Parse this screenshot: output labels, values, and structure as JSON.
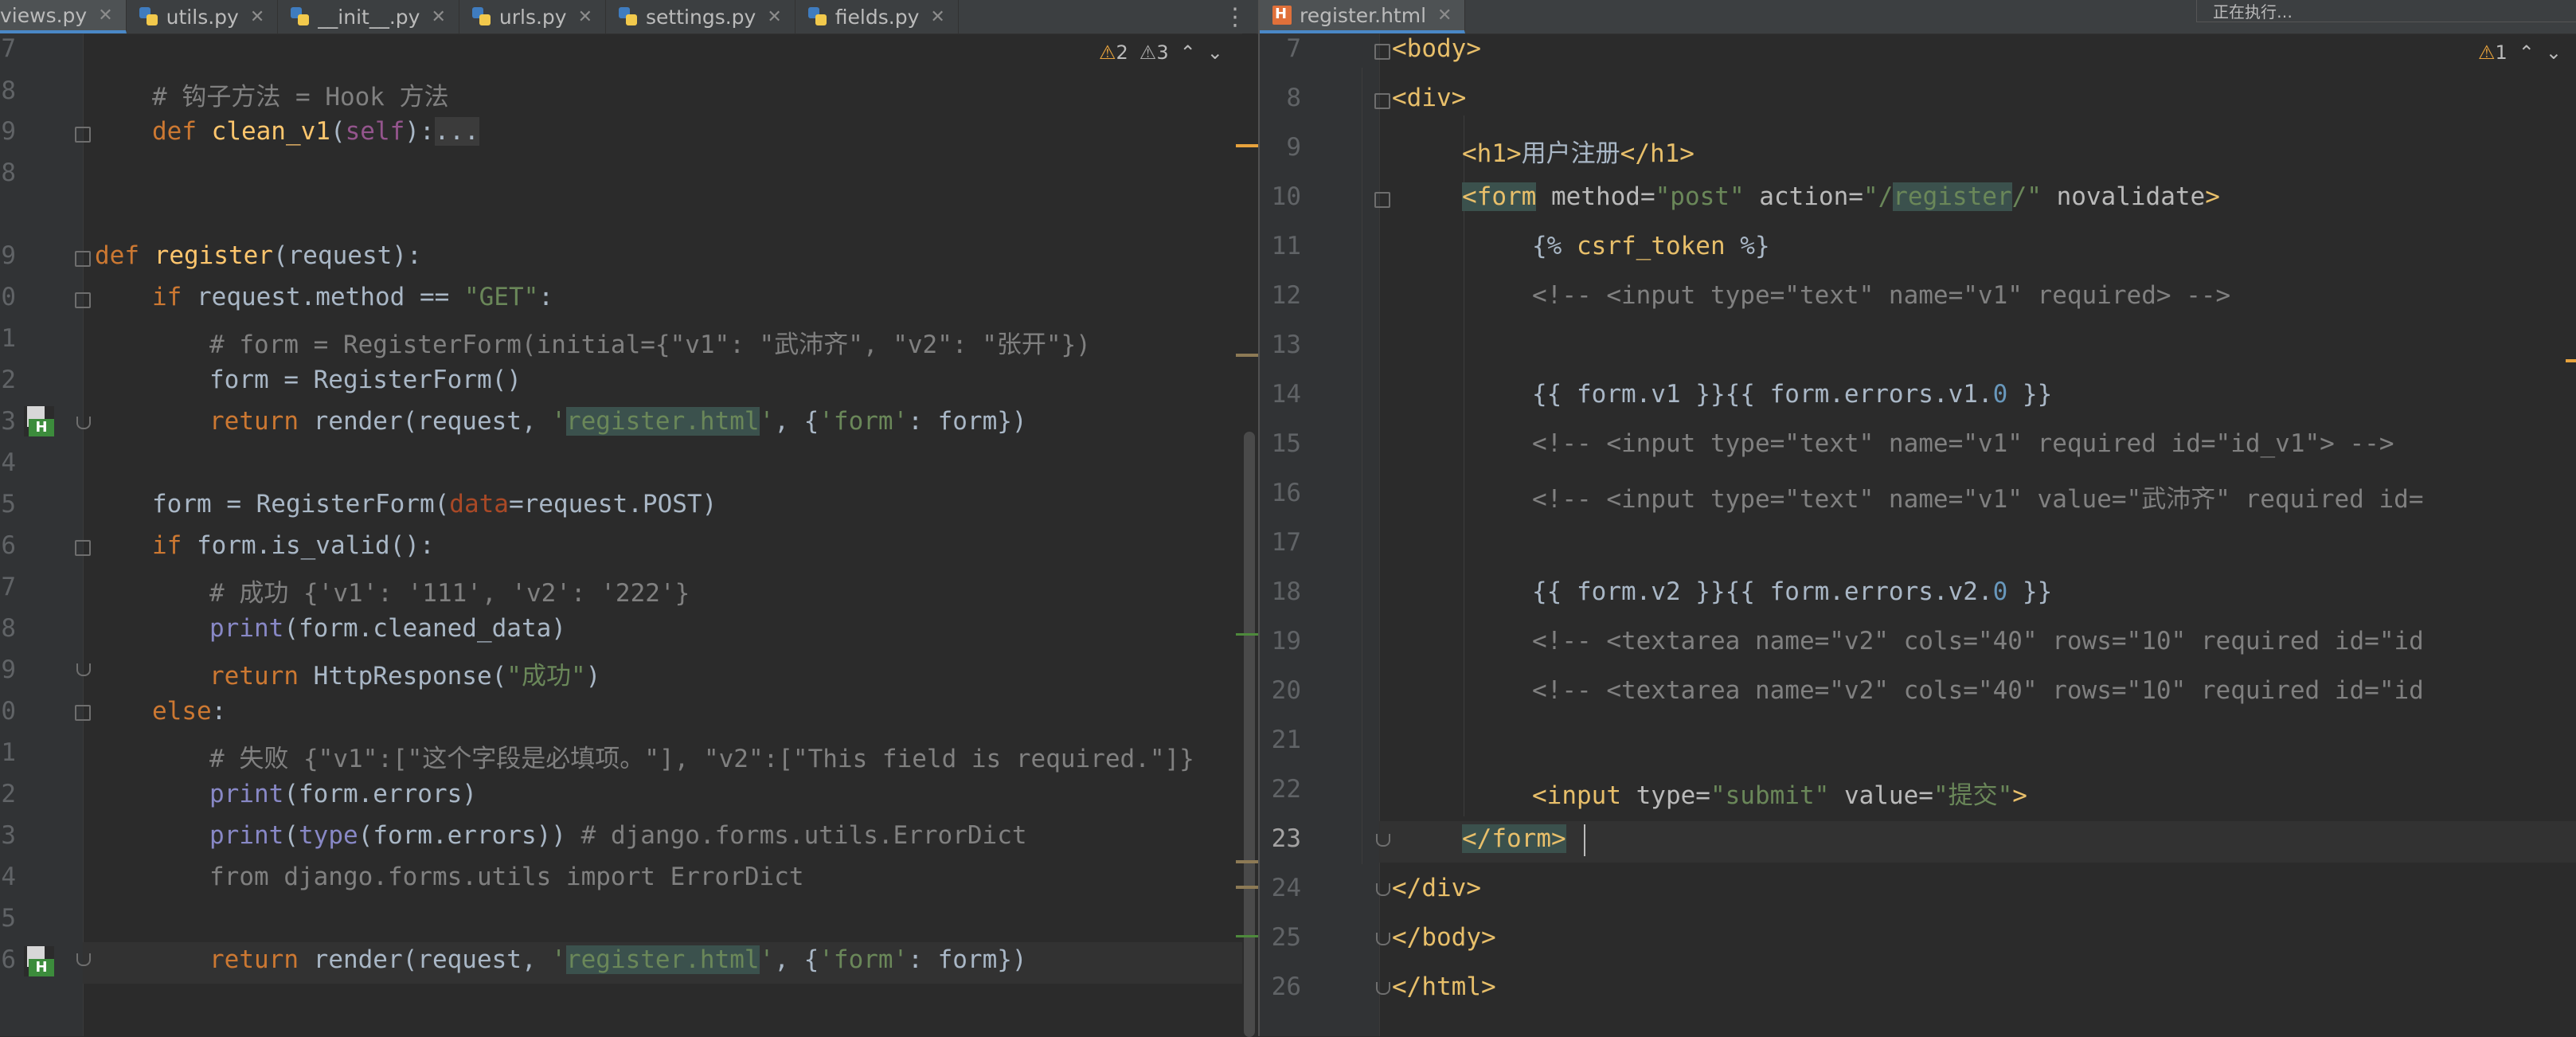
{
  "left_tabs": [
    {
      "label": "views.py",
      "active": true
    },
    {
      "label": "utils.py",
      "active": false
    },
    {
      "label": "__init__.py",
      "active": false
    },
    {
      "label": "urls.py",
      "active": false
    },
    {
      "label": "settings.py",
      "active": false
    },
    {
      "label": "fields.py",
      "active": false
    }
  ],
  "right_tabs": [
    {
      "label": "register.html",
      "active": true
    }
  ],
  "left_inspections": {
    "warnings": "2",
    "weak_warnings": "3"
  },
  "right_inspections": {
    "warnings": "1"
  },
  "popup_text": "正在执行…",
  "left_lines": [
    {
      "n": "7"
    },
    {
      "n": "8"
    },
    {
      "n": "9"
    },
    {
      "n": "8"
    },
    {
      "n": "9"
    },
    {
      "n": "0"
    },
    {
      "n": "1"
    },
    {
      "n": "2"
    },
    {
      "n": "3"
    },
    {
      "n": "4"
    },
    {
      "n": "5"
    },
    {
      "n": "6"
    },
    {
      "n": "7"
    },
    {
      "n": "8"
    },
    {
      "n": "9"
    },
    {
      "n": "0"
    },
    {
      "n": "1"
    },
    {
      "n": "2"
    },
    {
      "n": "3"
    },
    {
      "n": "4"
    },
    {
      "n": "5"
    },
    {
      "n": "6"
    }
  ],
  "left_code": {
    "l1": "# 钩子方法 = Hook 方法",
    "l2_kw": "def ",
    "l2_fn": "clean_v1",
    "l2_p1": "(",
    "l2_self": "self",
    "l2_p2": "):",
    "l2_dots": "...",
    "l5_kw": "def ",
    "l5_fn": "register",
    "l5_rest": "(request):",
    "l6_kw": "if ",
    "l6_mid": "request.method == ",
    "l6_str": "\"GET\"",
    "l6_end": ":",
    "l7": "# form = RegisterForm(initial={\"v1\": \"武沛齐\", \"v2\": \"张开\"})",
    "l8": "form = RegisterForm()",
    "l9_kw": "return ",
    "l9_a": "render(request, ",
    "l9_q1": "'",
    "l9_s": "register.html",
    "l9_q2": "'",
    "l9_b": ", {",
    "l9_k": "'form'",
    "l9_c": ": form})",
    "l11_a": "form = RegisterForm(",
    "l11_p": "data",
    "l11_b": "=request.POST)",
    "l12_kw": "if ",
    "l12_rest": "form.is_valid():",
    "l13": "# 成功 {'v1': '111', 'v2': '222'}",
    "l14_bi": "print",
    "l14_rest": "(form.cleaned_data)",
    "l15_kw": "return ",
    "l15_a": "HttpResponse(",
    "l15_s": "\"成功\"",
    "l15_b": ")",
    "l16_kw": "else",
    "l16_rest": ":",
    "l17": "# 失败 {\"v1\":[\"这个字段是必填项。\"], \"v2\":[\"This field is required.\"]}",
    "l18_bi": "print",
    "l18_rest": "(form.errors)",
    "l19_bi": "print",
    "l19_a": "(",
    "l19_bi2": "type",
    "l19_b": "(form.errors))",
    "l19_cm": " # django.forms.utils.ErrorDict",
    "l20": "from django.forms.utils import ErrorDict",
    "l22_kw": "return ",
    "l22_a": "render(request, ",
    "l22_q1": "'",
    "l22_s": "register.html",
    "l22_q2": "'",
    "l22_b": ", {",
    "l22_k": "'form'",
    "l22_c": ": form})"
  },
  "right_lines": [
    "7",
    "8",
    "9",
    "10",
    "11",
    "12",
    "13",
    "14",
    "15",
    "16",
    "17",
    "18",
    "19",
    "20",
    "21",
    "22",
    "23",
    "24",
    "25",
    "26"
  ],
  "right_code": {
    "r7": "<body>",
    "r8": "<div>",
    "r9_t1": "<h1>",
    "r9_txt": "用户注册",
    "r9_t2": "</h1>",
    "r10_t": "<form",
    "r10_a1": " method=",
    "r10_v1": "\"post\"",
    "r10_a2": " action=",
    "r10_v2a": "\"/",
    "r10_v2b": "register",
    "r10_v2c": "/\"",
    "r10_a3": " novalidate",
    "r10_end": ">",
    "r11_a": "{% ",
    "r11_b": "csrf_token",
    "r11_c": " %}",
    "r12": "<!-- <input type=\"text\" name=\"v1\" required> -->",
    "r14_a": "{{ form.v1 }}{{ form.errors.v1.",
    "r14_n": "0",
    "r14_b": " }}",
    "r15": "<!-- <input type=\"text\" name=\"v1\" required id=\"id_v1\"> -->",
    "r16": "<!-- <input type=\"text\" name=\"v1\" value=\"武沛齐\" required id=",
    "r18_a": "{{ form.v2 }}{{ form.errors.v2.",
    "r18_n": "0",
    "r18_b": " }}",
    "r19": "<!-- <textarea name=\"v2\" cols=\"40\" rows=\"10\" required id=\"id",
    "r20": "<!-- <textarea name=\"v2\" cols=\"40\" rows=\"10\" required id=\"id",
    "r22_t": "<input",
    "r22_a1": " type=",
    "r22_v1": "\"submit\"",
    "r22_a2": " value=",
    "r22_v2": "\"提交\"",
    "r22_end": ">",
    "r23": "</form>",
    "r24": "</div>",
    "r25": "</body>",
    "r26": "</html>"
  }
}
